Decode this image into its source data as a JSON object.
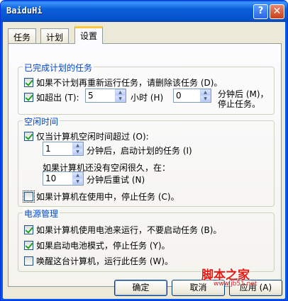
{
  "window": {
    "title": "BaiduHi",
    "help_glyph": "?",
    "close_glyph": "✕"
  },
  "tabs": [
    {
      "label": "任务"
    },
    {
      "label": "计划"
    },
    {
      "label": "设置"
    }
  ],
  "completed_group": {
    "title": "已完成计划的任务",
    "delete_if_not_rescheduled": {
      "label": "如果不计划再重新运行任务，请删除该任务 (D)。",
      "checked": true
    },
    "stop_if_runs_longer": {
      "label": "如超出 (T):",
      "checked": true
    },
    "hours_value": "5",
    "hours_label": "小时 (H)",
    "minutes_value": "0",
    "minutes_label_line1": "分钟后 (M)，",
    "minutes_label_line2": "停止任务。"
  },
  "idle_group": {
    "title": "空闲时间",
    "only_if_idle": {
      "label": "仅当计算机空闲时间超过 (O):",
      "checked": true
    },
    "idle_minutes_value": "1",
    "idle_minutes_label": "分钟后，启动计划的任务 (I)",
    "retry_prompt": "如果计算机还没有空闲很久，在：",
    "retry_value": "10",
    "retry_label": "分钟后重试 (N)",
    "stop_if_in_use": {
      "label": "如果计算机在使用中，停止任务 (C)。",
      "checked": false
    }
  },
  "power_group": {
    "title": "电源管理",
    "no_start_on_battery": {
      "label": "如果计算机使用电池来运行，不要启动任务 (B)。",
      "checked": true
    },
    "stop_on_battery": {
      "label": "如果启动电池模式，停止任务 (Y)。",
      "checked": true
    },
    "wake_to_run": {
      "label": "唤醒这台计算机，运行此任务 (W)。",
      "checked": false
    }
  },
  "buttons": {
    "ok": "确定",
    "cancel": "取消",
    "apply": "应用 (A)"
  },
  "watermark": {
    "text": "脚本之家",
    "url": "www.jb51.net"
  }
}
